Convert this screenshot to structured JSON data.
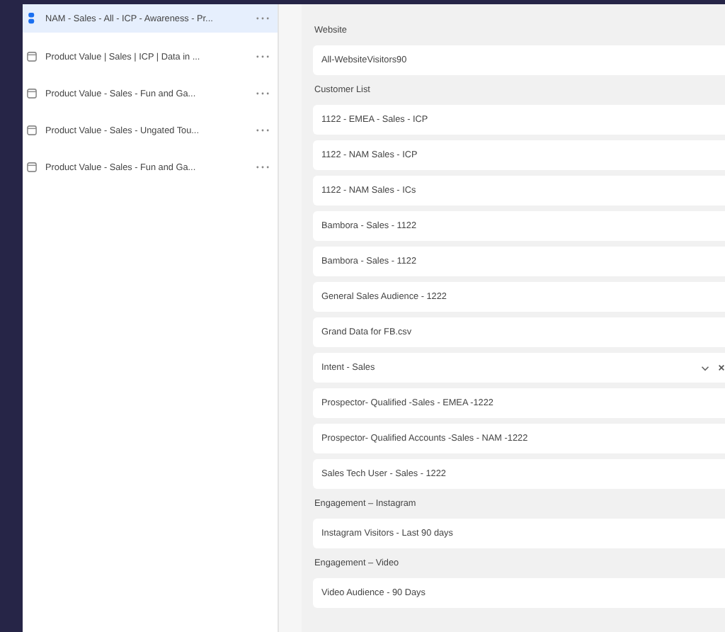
{
  "sidebar": {
    "items": [
      {
        "label": "NAM - Sales - All - ICP - Awareness - Pr...",
        "selected": true
      },
      {
        "label": "Product Value | Sales | ICP | Data in ...",
        "selected": false
      },
      {
        "label": "Product Value - Sales - Fun and Ga...",
        "selected": false
      },
      {
        "label": "Product Value - Sales - Ungated Tou...",
        "selected": false
      },
      {
        "label": "Product Value - Sales - Fun and Ga...",
        "selected": false
      }
    ]
  },
  "groups": [
    {
      "label": "Website",
      "rows": [
        {
          "kind": "value",
          "text": "All-WebsiteVisitors90"
        }
      ]
    },
    {
      "label": "Customer List",
      "rows": [
        {
          "kind": "value",
          "text": "1122 - EMEA - Sales - ICP"
        },
        {
          "kind": "value",
          "text": "1122 - NAM Sales - ICP"
        },
        {
          "kind": "value",
          "text": "1122 - NAM Sales - ICs"
        },
        {
          "kind": "value",
          "text": "Bambora - Sales - 1122"
        },
        {
          "kind": "value",
          "text": "Bambora - Sales - 1122"
        },
        {
          "kind": "value",
          "text": "General Sales Audience - 1222"
        },
        {
          "kind": "value",
          "text": "Grand Data for FB.csv"
        },
        {
          "kind": "select",
          "text": "Intent - Sales"
        },
        {
          "kind": "value",
          "text": "Prospector- Qualified -Sales - EMEA -1222"
        },
        {
          "kind": "value",
          "text": "Prospector- Qualified Accounts -Sales - NAM -1222"
        },
        {
          "kind": "value",
          "text": "Sales Tech User - Sales - 1222"
        }
      ]
    },
    {
      "label": "Engagement – Instagram",
      "rows": [
        {
          "kind": "value",
          "text": "Instagram Visitors - Last 90 days"
        }
      ]
    },
    {
      "label": "Engagement – Video",
      "rows": [
        {
          "kind": "value",
          "text": "Video Audience - 90 Days"
        }
      ]
    }
  ]
}
